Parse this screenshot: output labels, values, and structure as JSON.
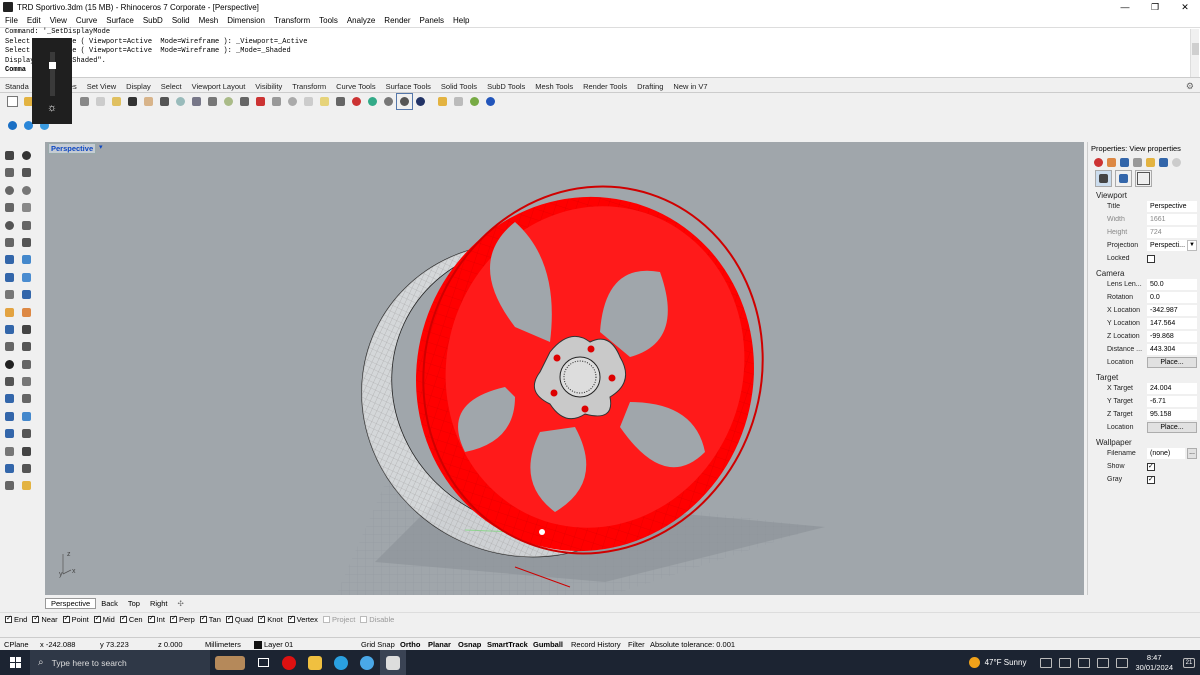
{
  "window": {
    "title": "TRD Sportivo.3dm (15 MB) - Rhinoceros 7 Corporate - [Perspective]",
    "min": "—",
    "max": "❐",
    "close": "✕"
  },
  "menu": [
    "File",
    "Edit",
    "View",
    "Curve",
    "Surface",
    "SubD",
    "Solid",
    "Mesh",
    "Dimension",
    "Transform",
    "Tools",
    "Analyze",
    "Render",
    "Panels",
    "Help"
  ],
  "command_history": [
    "Command: '_SetDisplayMode",
    "Select a        e ( Viewport=Active  Mode=Wireframe ): _Viewport=_Active",
    "Select a        e ( Viewport=Active  Mode=Wireframe ): _Mode=_Shaded",
    "Display        \"Shaded\"."
  ],
  "command_prompt": "Comma",
  "toolbar_tabs": [
    "Standa",
    "es",
    "Set View",
    "Display",
    "Select",
    "Viewport Layout",
    "Visibility",
    "Transform",
    "Curve Tools",
    "Surface Tools",
    "Solid Tools",
    "SubD Tools",
    "Mesh Tools",
    "Render Tools",
    "Drafting",
    "New in V7"
  ],
  "viewport": {
    "label": "Perspective",
    "arrow": "▾",
    "axis_z": "z",
    "axis_y": "y",
    "axis_x": "x"
  },
  "viewport_tabs": [
    "Perspective",
    "Back",
    "Top",
    "Right",
    "✣"
  ],
  "osnaps": [
    {
      "label": "End",
      "on": true
    },
    {
      "label": "Near",
      "on": true
    },
    {
      "label": "Point",
      "on": true
    },
    {
      "label": "Mid",
      "on": true
    },
    {
      "label": "Cen",
      "on": true
    },
    {
      "label": "Int",
      "on": true
    },
    {
      "label": "Perp",
      "on": true
    },
    {
      "label": "Tan",
      "on": true
    },
    {
      "label": "Quad",
      "on": true
    },
    {
      "label": "Knot",
      "on": true
    },
    {
      "label": "Vertex",
      "on": true
    },
    {
      "label": "Project",
      "on": false
    },
    {
      "label": "Disable",
      "on": false
    }
  ],
  "status": {
    "cplane": "CPlane",
    "x": "x -242.088",
    "y": "y 73.223",
    "z": "z 0.000",
    "units": "Millimeters",
    "layer": "Layer 01",
    "grid_snap": "Grid Snap",
    "ortho": "Ortho",
    "planar": "Planar",
    "osnap": "Osnap",
    "smarttrack": "SmartTrack",
    "gumball": "Gumball",
    "record_history": "Record History",
    "filter": "Filter",
    "tolerance": "Absolute tolerance: 0.001"
  },
  "properties": {
    "header": "Properties: View properties",
    "viewport_section": "Viewport",
    "title_k": "Title",
    "title_v": "Perspective",
    "width_k": "Width",
    "width_v": "1661",
    "height_k": "Height",
    "height_v": "724",
    "projection_k": "Projection",
    "projection_v": "Perspecti...",
    "locked_k": "Locked",
    "camera_section": "Camera",
    "lens_k": "Lens Len...",
    "lens_v": "50.0",
    "rotation_k": "Rotation",
    "rotation_v": "0.0",
    "xloc_k": "X Location",
    "xloc_v": "-342.987",
    "yloc_k": "Y Location",
    "yloc_v": "147.564",
    "zloc_k": "Z Location",
    "zloc_v": "-99.868",
    "dist_k": "Distance ...",
    "dist_v": "443.304",
    "loc_k": "Location",
    "place_btn": "Place...",
    "target_section": "Target",
    "xt_k": "X Target",
    "xt_v": "24.004",
    "yt_k": "Y Target",
    "yt_v": "-6.71",
    "zt_k": "Z Target",
    "zt_v": "95.158",
    "tloc_k": "Location",
    "wallpaper_section": "Wallpaper",
    "file_k": "Filename",
    "file_v": "(none)",
    "file_btn": "...",
    "show_k": "Show",
    "gray_k": "Gray"
  },
  "taskbar": {
    "search_placeholder": "Type here to search",
    "weather": "47°F  Sunny",
    "time": "8:47",
    "date": "30/01/2024",
    "notif": "21"
  },
  "colors": {
    "wheel": "#ff0000",
    "viewport_bg": "#a0a6ab",
    "accent": "#0d47c2"
  }
}
